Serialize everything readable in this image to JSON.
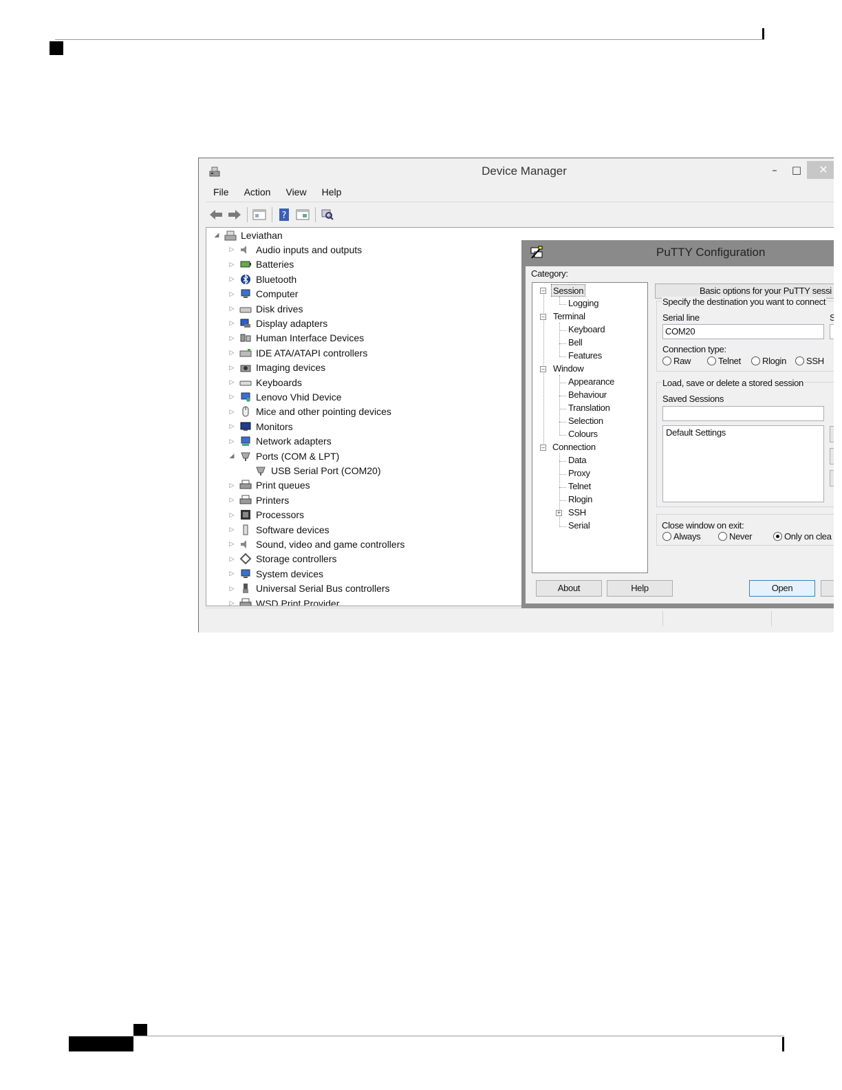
{
  "device_manager": {
    "title": "Device Manager",
    "menu": [
      "File",
      "Action",
      "View",
      "Help"
    ],
    "toolbar_icons": [
      "back-arrow-icon",
      "forward-arrow-icon",
      "properties-icon",
      "help-icon",
      "update-driver-icon",
      "scan-hardware-icon"
    ],
    "tree": {
      "root": "Leviathan",
      "items": [
        {
          "label": "Audio inputs and outputs",
          "icon": "speaker-icon"
        },
        {
          "label": "Batteries",
          "icon": "battery-icon"
        },
        {
          "label": "Bluetooth",
          "icon": "bluetooth-icon"
        },
        {
          "label": "Computer",
          "icon": "computer-icon"
        },
        {
          "label": "Disk drives",
          "icon": "disk-drive-icon"
        },
        {
          "label": "Display adapters",
          "icon": "display-adapter-icon"
        },
        {
          "label": "Human Interface Devices",
          "icon": "hid-icon"
        },
        {
          "label": "IDE ATA/ATAPI controllers",
          "icon": "ide-controller-icon"
        },
        {
          "label": "Imaging devices",
          "icon": "camera-icon"
        },
        {
          "label": "Keyboards",
          "icon": "keyboard-icon"
        },
        {
          "label": "Lenovo Vhid Device",
          "icon": "hid-device-icon"
        },
        {
          "label": "Mice and other pointing devices",
          "icon": "mouse-icon"
        },
        {
          "label": "Monitors",
          "icon": "monitor-icon"
        },
        {
          "label": "Network adapters",
          "icon": "network-adapter-icon"
        },
        {
          "label": "Ports (COM & LPT)",
          "icon": "port-icon",
          "expanded": true,
          "children": [
            "USB Serial Port (COM20)"
          ]
        },
        {
          "label": "Print queues",
          "icon": "printer-icon"
        },
        {
          "label": "Printers",
          "icon": "printer-icon"
        },
        {
          "label": "Processors",
          "icon": "processor-icon"
        },
        {
          "label": "Software devices",
          "icon": "software-device-icon"
        },
        {
          "label": "Sound, video and game controllers",
          "icon": "speaker-icon"
        },
        {
          "label": "Storage controllers",
          "icon": "storage-controller-icon"
        },
        {
          "label": "System devices",
          "icon": "computer-icon"
        },
        {
          "label": "Universal Serial Bus controllers",
          "icon": "usb-icon"
        },
        {
          "label": "WSD Print Provider",
          "icon": "printer-icon"
        }
      ]
    }
  },
  "putty": {
    "title": "PuTTY Configuration",
    "category_label": "Category:",
    "categories": {
      "session": "Session",
      "logging": "Logging",
      "terminal": "Terminal",
      "keyboard": "Keyboard",
      "bell": "Bell",
      "features": "Features",
      "window": "Window",
      "appearance": "Appearance",
      "behaviour": "Behaviour",
      "translation": "Translation",
      "selection": "Selection",
      "colours": "Colours",
      "connection": "Connection",
      "data": "Data",
      "proxy": "Proxy",
      "telnet": "Telnet",
      "rlogin": "Rlogin",
      "ssh": "SSH",
      "serial": "Serial"
    },
    "panel_header": "Basic options for your PuTTY sessi",
    "destination_label": "Specify the destination you want to connect",
    "serial_line_label": "Serial line",
    "speed_label_partial": "S",
    "serial_line_value": "COM20",
    "connection_type_label": "Connection type:",
    "connection_types": [
      "Raw",
      "Telnet",
      "Rlogin",
      "SSH"
    ],
    "sessions_group_label": "Load, save or delete a stored session",
    "saved_sessions_label": "Saved Sessions",
    "saved_sessions_value": "",
    "saved_sessions_list": [
      "Default Settings"
    ],
    "close_window_label": "Close window on exit:",
    "close_options": [
      "Always",
      "Never",
      "Only on clea"
    ],
    "close_selected": "Only on clea",
    "buttons": {
      "about": "About",
      "help": "Help",
      "open": "Open"
    }
  }
}
